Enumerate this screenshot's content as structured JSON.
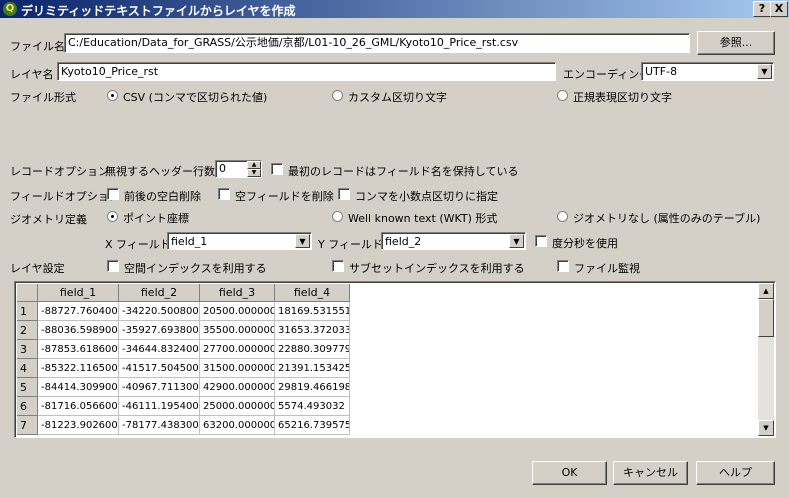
{
  "window": {
    "title": "デリミティッドテキストファイルからレイヤを作成",
    "help_btn": "?",
    "close_btn": "X"
  },
  "file": {
    "label": "ファイル名",
    "value": "C:/Education/Data_for_GRASS/公示地価/京都/L01-10_26_GML/Kyoto10_Price_rst.csv",
    "browse": "参照..."
  },
  "layer": {
    "label": "レイヤ名",
    "value": "Kyoto10_Price_rst",
    "encoding_label": "エンコーディング",
    "encoding_value": "UTF-8"
  },
  "file_format": {
    "label": "ファイル形式",
    "options": [
      "CSV (コンマで区切られた値)",
      "カスタム区切り文字",
      "正規表現区切り文字"
    ],
    "selected": 0
  },
  "record_options": {
    "label": "レコードオプション",
    "skip_label": "無視するヘッダー行数",
    "skip_value": "0",
    "first_record": "最初のレコードはフィールド名を保持している"
  },
  "field_options": {
    "label": "フィールドオプション",
    "trim": "前後の空白削除",
    "skip_empty": "空フィールドを削除",
    "decimal_comma": "コンマを小数点区切りに指定"
  },
  "geometry": {
    "label": "ジオメトリ定義",
    "options": [
      "ポイント座標",
      "Well known text (WKT) 形式",
      "ジオメトリなし (属性のみのテーブル)"
    ],
    "selected": 0,
    "x_label": "X フィールド",
    "x_value": "field_1",
    "y_label": "Y フィールド",
    "y_value": "field_2",
    "dms": "度分秒を使用"
  },
  "layer_settings": {
    "label": "レイヤ設定",
    "spatial_index": "空間インデックスを利用する",
    "subset_index": "サブセットインデックスを利用する",
    "watch_file": "ファイル監視"
  },
  "table": {
    "columns": [
      "field_1",
      "field_2",
      "field_3",
      "field_4"
    ],
    "rows": [
      {
        "num": "1",
        "cells": [
          "-88727.760400",
          "-34220.500800",
          "20500.000000",
          "18169.531551"
        ]
      },
      {
        "num": "2",
        "cells": [
          "-88036.598900",
          "-35927.693800",
          "35500.000000",
          "31653.372033"
        ]
      },
      {
        "num": "3",
        "cells": [
          "-87853.618600",
          "-34644.832400",
          "27700.000000",
          "22880.309779"
        ]
      },
      {
        "num": "4",
        "cells": [
          "-85322.116500",
          "-41517.504500",
          "31500.000000",
          "21391.153425"
        ]
      },
      {
        "num": "5",
        "cells": [
          "-84414.309900",
          "-40967.711300",
          "42900.000000",
          "29819.466198"
        ]
      },
      {
        "num": "6",
        "cells": [
          "-81716.056600",
          "-46111.195400",
          "25000.000000",
          "5574.493032"
        ]
      },
      {
        "num": "7",
        "cells": [
          "-81223.902600",
          "-78177.438300",
          "63200.000000",
          "65216.739575"
        ]
      }
    ]
  },
  "buttons": {
    "ok": "OK",
    "cancel": "キャンセル",
    "help": "ヘルプ"
  }
}
